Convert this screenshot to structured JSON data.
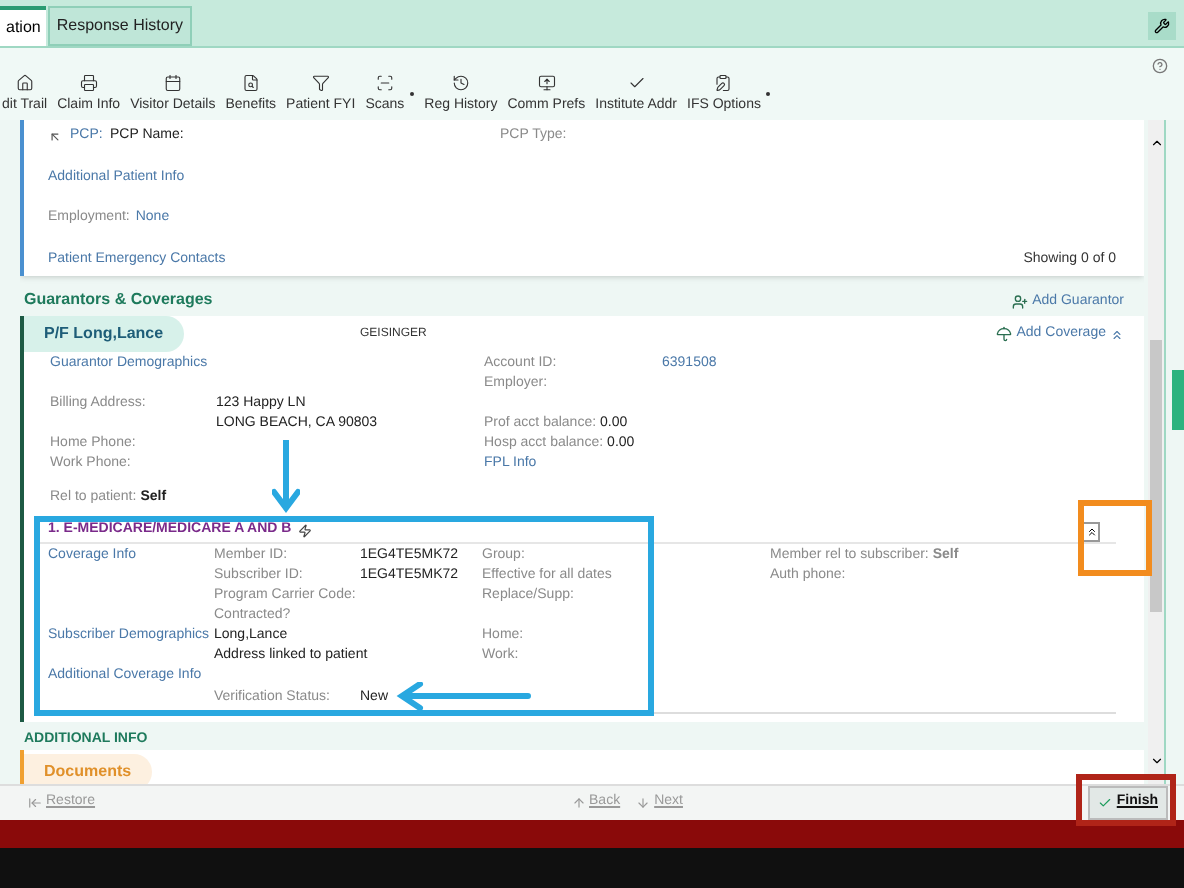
{
  "tabs": [
    {
      "label": "ation",
      "selected": true
    },
    {
      "label": "Response History",
      "selected": false
    }
  ],
  "toolbar": [
    {
      "label": "dit Trail",
      "has_menu": false
    },
    {
      "label": "Claim Info",
      "has_menu": false
    },
    {
      "label": "Visitor Details",
      "has_menu": false
    },
    {
      "label": "Benefits",
      "has_menu": false
    },
    {
      "label": "Patient FYI",
      "has_menu": false
    },
    {
      "label": "Scans",
      "has_menu": true
    },
    {
      "label": "Reg History",
      "has_menu": false
    },
    {
      "label": "Comm Prefs",
      "has_menu": false
    },
    {
      "label": "Institute Addr",
      "has_menu": false
    },
    {
      "label": "IFS Options",
      "has_menu": true
    }
  ],
  "pcp_panel": {
    "pcp_label": "PCP:",
    "pcp_name_label": "PCP Name:",
    "pcp_type_label": "PCP Type:",
    "additional_link": "Additional Patient Info",
    "employment_label": "Employment:",
    "employment_value": "None",
    "emergency_link": "Patient Emergency Contacts",
    "showing": "Showing 0 of 0"
  },
  "guarantors": {
    "heading": "Guarantors & Coverages",
    "add_guarantor": "Add Guarantor",
    "add_coverage": "Add Coverage",
    "name": "P/F Long,Lance",
    "payer": "GEISINGER",
    "rows": [
      {
        "link": "Guarantor Demographics",
        "right_label": "Account ID:",
        "right_link_value": "6391508"
      },
      {
        "right_label": "Employer:"
      },
      {
        "label": "Billing Address:",
        "value": "123 Happy LN"
      },
      {
        "value": "LONG BEACH, CA 90803",
        "right_label": "Prof acct balance:",
        "right_value": "0.00"
      },
      {
        "label": "Home Phone:",
        "right_label": "Hosp acct balance:",
        "right_value": "0.00"
      },
      {
        "label": "Work Phone:",
        "right_link": "FPL Info"
      },
      {
        "label": "Rel to patient:",
        "inline_value": "Self"
      }
    ]
  },
  "coverage": {
    "title": "1. E-MEDICARE/MEDICARE A AND B",
    "rows": [
      {
        "link": "Coverage Info",
        "label": "Member ID:",
        "value": "1EG4TE5MK72",
        "label_2": "Group:",
        "extra": "Member rel to subscriber: **Self**"
      },
      {
        "label": "Subscriber ID:",
        "value": "1EG4TE5MK72",
        "label_2": "Effective for all dates",
        "extra": "Auth phone:"
      },
      {
        "label": "Program Carrier Code:",
        "label_2": "Replace/Supp:"
      },
      {
        "label": "Contracted?"
      },
      {
        "link": "Subscriber Demographics",
        "value_wide": "Long,Lance",
        "label_2": "Home:"
      },
      {
        "value_wide": "Address linked to patient",
        "label_2": "Work:"
      },
      {
        "link": "Additional Coverage Info"
      },
      {
        "label": "Verification Status:",
        "value": "New"
      }
    ]
  },
  "additional_info": {
    "heading": "ADDITIONAL INFO",
    "documents": "Documents"
  },
  "footer": [
    {
      "label": "Restore",
      "kind": "restore",
      "disabled": true
    },
    {
      "label": "Back",
      "kind": "back",
      "disabled": true
    },
    {
      "label": "Next",
      "kind": "next",
      "disabled": true
    },
    {
      "label": "Finish",
      "kind": "finish",
      "disabled": false
    }
  ]
}
